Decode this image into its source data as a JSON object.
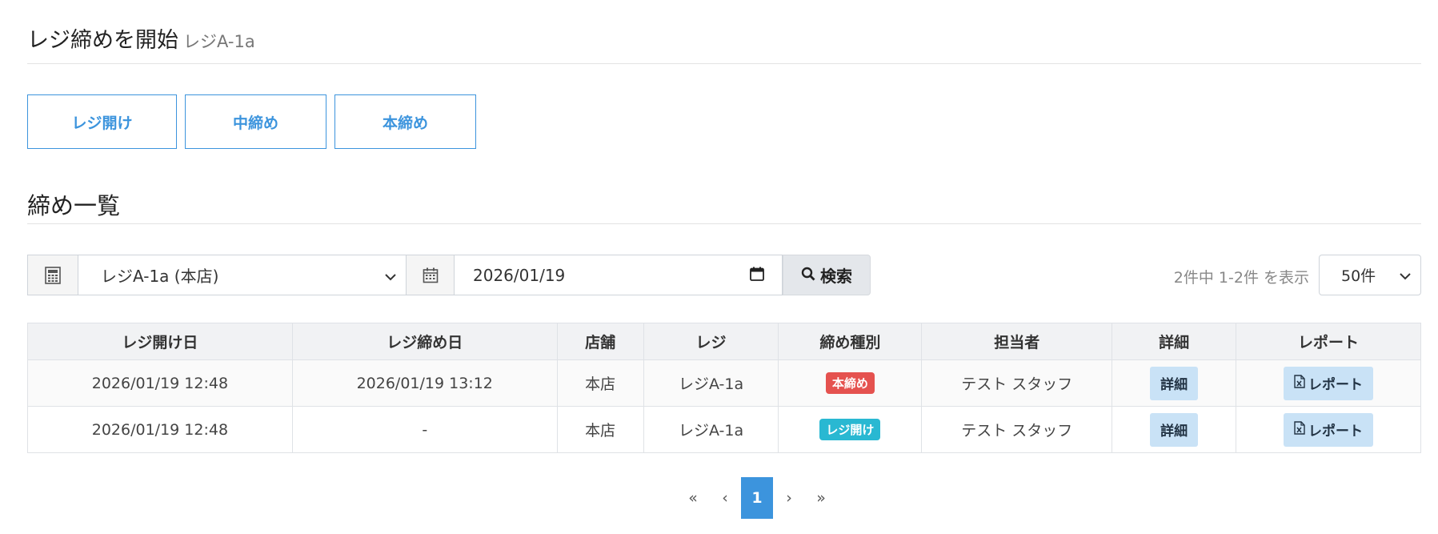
{
  "header": {
    "title": "レジ締めを開始",
    "subtitle": "レジA-1a"
  },
  "actions": {
    "open_label": "レジ開け",
    "middle_label": "中締め",
    "final_label": "本締め"
  },
  "list_section": {
    "title": "締め一覧"
  },
  "filters": {
    "register_icon": "calculator-icon",
    "register_value": "レジA-1a (本店)",
    "date_icon": "calendar-icon",
    "date_value": "2026/01/19",
    "search_label": "検索",
    "count_text": "2件中 1-2件 を表示",
    "per_page_value": "50件"
  },
  "table": {
    "headers": [
      "レジ開け日",
      "レジ締め日",
      "店舗",
      "レジ",
      "締め種別",
      "担当者",
      "詳細",
      "レポート"
    ],
    "rows": [
      {
        "open_date": "2026/01/19 12:48",
        "close_date": "2026/01/19 13:12",
        "store": "本店",
        "register": "レジA-1a",
        "type": "本締め",
        "type_color": "#e5524f",
        "staff": "テスト スタッフ",
        "detail_label": "詳細",
        "report_label": "レポート"
      },
      {
        "open_date": "2026/01/19 12:48",
        "close_date": "-",
        "store": "本店",
        "register": "レジA-1a",
        "type": "レジ開け",
        "type_color": "#29b8d2",
        "staff": "テスト スタッフ",
        "detail_label": "詳細",
        "report_label": "レポート"
      }
    ]
  },
  "pagination": {
    "first": "«",
    "prev": "‹",
    "current": "1",
    "next": "›",
    "last": "»"
  },
  "colors": {
    "primary": "#3c94dd",
    "danger": "#e5524f",
    "info": "#29b8d2"
  }
}
